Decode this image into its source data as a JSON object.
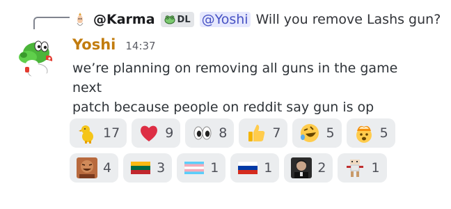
{
  "reply": {
    "username": "@Karma",
    "tag": "DL",
    "mention": "@Yoshi",
    "text": "Will you remove Lashs gun?"
  },
  "message": {
    "author": "Yoshi",
    "time": "14:37",
    "lines": [
      "we’re planning on removing all guns in the game next",
      "patch because people on reddit say gun is op"
    ]
  },
  "reactions": [
    {
      "emoji": "duck-icon",
      "count": "17"
    },
    {
      "emoji": "red-heart-icon",
      "count": "9"
    },
    {
      "emoji": "eyes-icon",
      "count": "8"
    },
    {
      "emoji": "thumbs-up-icon",
      "count": "7"
    },
    {
      "emoji": "rolling-laughing-icon",
      "count": "5"
    },
    {
      "emoji": "mind-blown-icon",
      "count": "5"
    },
    {
      "emoji": "laughing-man-photo-icon",
      "count": "4"
    },
    {
      "emoji": "lithuania-flag-icon",
      "count": "3"
    },
    {
      "emoji": "transgender-flag-icon",
      "count": "1"
    },
    {
      "emoji": "russia-flag-icon",
      "count": "1"
    },
    {
      "emoji": "man-photo-icon",
      "count": "2"
    },
    {
      "emoji": "dancing-figure-icon",
      "count": "1"
    }
  ],
  "colors": {
    "author_name": "#c27c0e",
    "mention_bg": "#e6e8fd",
    "mention_text": "#4752c4",
    "reaction_bg": "#ebedef"
  }
}
